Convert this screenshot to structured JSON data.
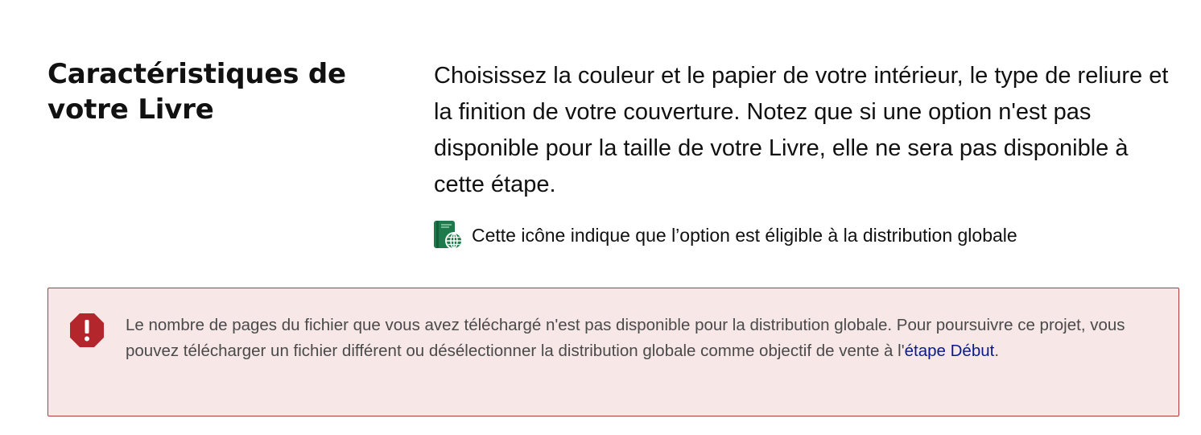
{
  "section": {
    "title": "Caractéristiques de votre Livre",
    "intro": "Choisissez la couleur et le papier de votre intérieur, le type de reliure et la finition de votre couverture. Notez que si une option n'est pas disponible pour la taille de votre Livre, elle ne sera pas disponible à cette étape.",
    "legend": {
      "icon": "global-distribution-book-icon",
      "text": "Cette icône indique que l’option est éligible à la distribution globale"
    }
  },
  "alert": {
    "icon": "warning-octagon-icon",
    "text_before": "Le nombre de pages du fichier que vous avez téléchargé n'est pas disponible pour la distribution globale. Pour poursuivre ce projet, vous pouvez télécharger un fichier différent ou désélectionner la distribution globale comme objectif de vente à l'",
    "link_label": "étape Début",
    "text_after": "."
  },
  "colors": {
    "icon_green": "#1e7a4a",
    "alert_red": "#b3262b",
    "alert_background": "#f7e7e7",
    "alert_border": "#b03a3a",
    "link": "#0a1a8c"
  }
}
